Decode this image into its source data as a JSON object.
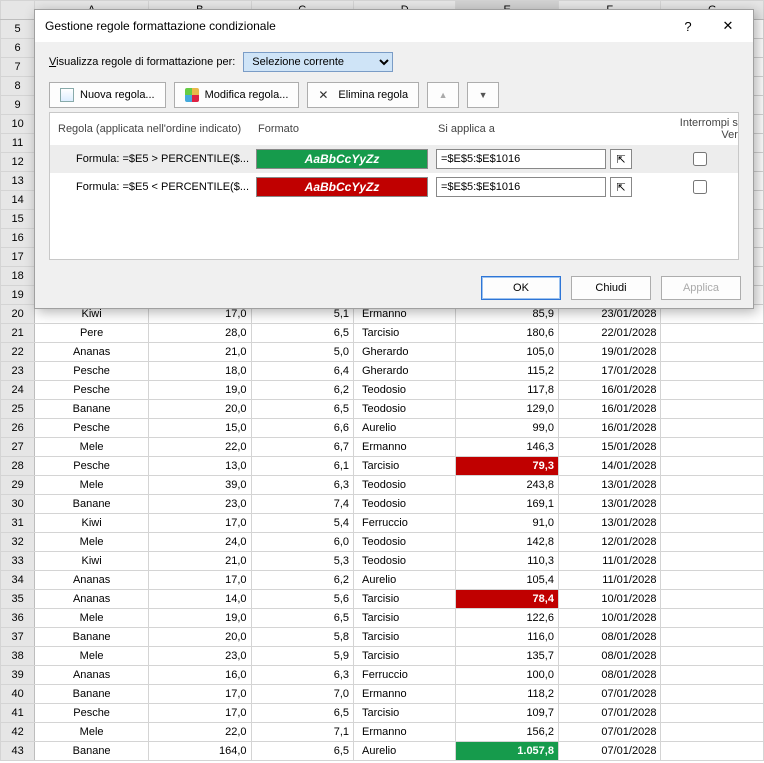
{
  "dialog": {
    "title": "Gestione regole formattazione condizionale",
    "scope_label_html": "Visualizza regole di formattazione per:",
    "scope_value": "Selezione corrente",
    "btn_new": "Nuova regola...",
    "btn_edit": "Modifica regola...",
    "btn_delete": "Elimina regola",
    "col_rule": "Regola (applicata nell'ordine indicato)",
    "col_format": "Formato",
    "col_applies": "Si applica a",
    "col_stop": "Interrompi se Vera",
    "rules": [
      {
        "formula": "Formula: =$E5 > PERCENTILE($...",
        "applies": "=$E$5:$E$1016",
        "preview": "AaBbCcYyZz",
        "style": "green",
        "stop": false,
        "selected": true
      },
      {
        "formula": "Formula: =$E5 < PERCENTILE($...",
        "applies": "=$E$5:$E$1016",
        "preview": "AaBbCcYyZz",
        "style": "red",
        "stop": false,
        "selected": false
      }
    ],
    "btn_ok": "OK",
    "btn_close": "Chiudi",
    "btn_apply": "Applica"
  },
  "columns": [
    "A",
    "B",
    "C",
    "D",
    "E",
    "F",
    "G"
  ],
  "selected_col": "E",
  "row_start": 5,
  "blank_rows": [
    5,
    6,
    7,
    8,
    9,
    10,
    11,
    12,
    13,
    14,
    15,
    16,
    17,
    18,
    19
  ],
  "chart_data": {
    "type": "table",
    "columns": [
      "row",
      "A",
      "B",
      "C",
      "D",
      "E",
      "F"
    ],
    "data": [
      {
        "row": 20,
        "A": "Kiwi",
        "B": "17,0",
        "C": "5,1",
        "D": "Ermanno",
        "E": "85,9",
        "F": "23/01/2028",
        "hl": null
      },
      {
        "row": 21,
        "A": "Pere",
        "B": "28,0",
        "C": "6,5",
        "D": "Tarcisio",
        "E": "180,6",
        "F": "22/01/2028",
        "hl": null
      },
      {
        "row": 22,
        "A": "Ananas",
        "B": "21,0",
        "C": "5,0",
        "D": "Gherardo",
        "E": "105,0",
        "F": "19/01/2028",
        "hl": null
      },
      {
        "row": 23,
        "A": "Pesche",
        "B": "18,0",
        "C": "6,4",
        "D": "Gherardo",
        "E": "115,2",
        "F": "17/01/2028",
        "hl": null
      },
      {
        "row": 24,
        "A": "Pesche",
        "B": "19,0",
        "C": "6,2",
        "D": "Teodosio",
        "E": "117,8",
        "F": "16/01/2028",
        "hl": null
      },
      {
        "row": 25,
        "A": "Banane",
        "B": "20,0",
        "C": "6,5",
        "D": "Teodosio",
        "E": "129,0",
        "F": "16/01/2028",
        "hl": null
      },
      {
        "row": 26,
        "A": "Pesche",
        "B": "15,0",
        "C": "6,6",
        "D": "Aurelio",
        "E": "99,0",
        "F": "16/01/2028",
        "hl": null
      },
      {
        "row": 27,
        "A": "Mele",
        "B": "22,0",
        "C": "6,7",
        "D": "Ermanno",
        "E": "146,3",
        "F": "15/01/2028",
        "hl": null
      },
      {
        "row": 28,
        "A": "Pesche",
        "B": "13,0",
        "C": "6,1",
        "D": "Tarcisio",
        "E": "79,3",
        "F": "14/01/2028",
        "hl": "red"
      },
      {
        "row": 29,
        "A": "Mele",
        "B": "39,0",
        "C": "6,3",
        "D": "Teodosio",
        "E": "243,8",
        "F": "13/01/2028",
        "hl": null
      },
      {
        "row": 30,
        "A": "Banane",
        "B": "23,0",
        "C": "7,4",
        "D": "Teodosio",
        "E": "169,1",
        "F": "13/01/2028",
        "hl": null
      },
      {
        "row": 31,
        "A": "Kiwi",
        "B": "17,0",
        "C": "5,4",
        "D": "Ferruccio",
        "E": "91,0",
        "F": "13/01/2028",
        "hl": null
      },
      {
        "row": 32,
        "A": "Mele",
        "B": "24,0",
        "C": "6,0",
        "D": "Teodosio",
        "E": "142,8",
        "F": "12/01/2028",
        "hl": null
      },
      {
        "row": 33,
        "A": "Kiwi",
        "B": "21,0",
        "C": "5,3",
        "D": "Teodosio",
        "E": "110,3",
        "F": "11/01/2028",
        "hl": null
      },
      {
        "row": 34,
        "A": "Ananas",
        "B": "17,0",
        "C": "6,2",
        "D": "Aurelio",
        "E": "105,4",
        "F": "11/01/2028",
        "hl": null
      },
      {
        "row": 35,
        "A": "Ananas",
        "B": "14,0",
        "C": "5,6",
        "D": "Tarcisio",
        "E": "78,4",
        "F": "10/01/2028",
        "hl": "red"
      },
      {
        "row": 36,
        "A": "Mele",
        "B": "19,0",
        "C": "6,5",
        "D": "Tarcisio",
        "E": "122,6",
        "F": "10/01/2028",
        "hl": null
      },
      {
        "row": 37,
        "A": "Banane",
        "B": "20,0",
        "C": "5,8",
        "D": "Tarcisio",
        "E": "116,0",
        "F": "08/01/2028",
        "hl": null
      },
      {
        "row": 38,
        "A": "Mele",
        "B": "23,0",
        "C": "5,9",
        "D": "Tarcisio",
        "E": "135,7",
        "F": "08/01/2028",
        "hl": null
      },
      {
        "row": 39,
        "A": "Ananas",
        "B": "16,0",
        "C": "6,3",
        "D": "Ferruccio",
        "E": "100,0",
        "F": "08/01/2028",
        "hl": null
      },
      {
        "row": 40,
        "A": "Banane",
        "B": "17,0",
        "C": "7,0",
        "D": "Ermanno",
        "E": "118,2",
        "F": "07/01/2028",
        "hl": null
      },
      {
        "row": 41,
        "A": "Pesche",
        "B": "17,0",
        "C": "6,5",
        "D": "Tarcisio",
        "E": "109,7",
        "F": "07/01/2028",
        "hl": null
      },
      {
        "row": 42,
        "A": "Mele",
        "B": "22,0",
        "C": "7,1",
        "D": "Ermanno",
        "E": "156,2",
        "F": "07/01/2028",
        "hl": null
      },
      {
        "row": 43,
        "A": "Banane",
        "B": "164,0",
        "C": "6,5",
        "D": "Aurelio",
        "E": "1.057,8",
        "F": "07/01/2028",
        "hl": "green"
      }
    ]
  }
}
